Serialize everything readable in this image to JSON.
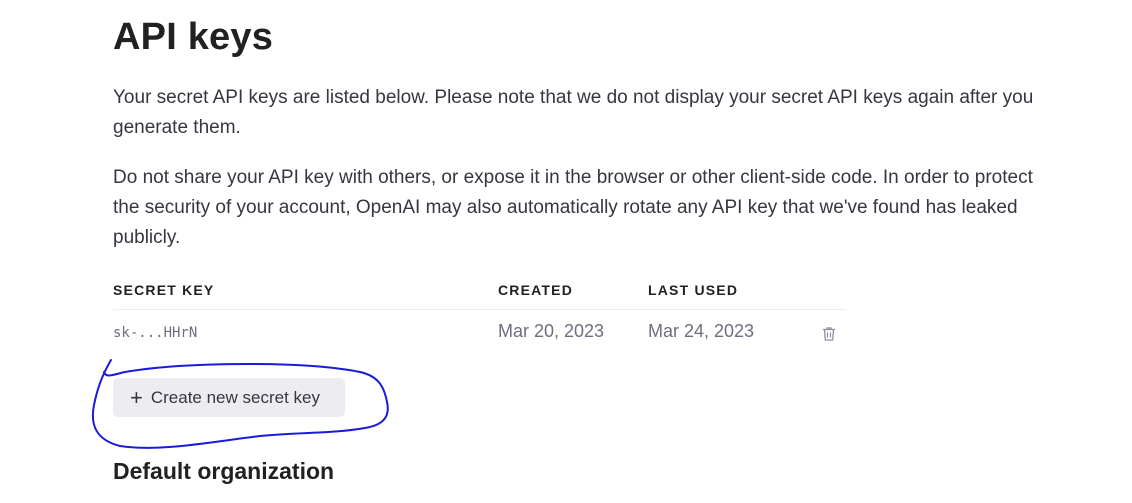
{
  "page": {
    "title": "API keys",
    "description_1": "Your secret API keys are listed below. Please note that we do not display your secret API keys again after you generate them.",
    "description_2": "Do not share your API key with others, or expose it in the browser or other client-side code. In order to protect the security of your account, OpenAI may also automatically rotate any API key that we've found has leaked publicly."
  },
  "table": {
    "headers": {
      "secret_key": "SECRET KEY",
      "created": "CREATED",
      "last_used": "LAST USED"
    },
    "rows": [
      {
        "secret_key": "sk-...HHrN",
        "created": "Mar 20, 2023",
        "last_used": "Mar 24, 2023",
        "action_icon": "trash-icon"
      }
    ]
  },
  "actions": {
    "create_label": "Create new secret key",
    "create_icon": "plus-icon"
  },
  "sections": {
    "default_org_title": "Default organization"
  },
  "colors": {
    "text": "#353740",
    "heading": "#202123",
    "muted": "#6e6e80",
    "button_bg": "#ececf1",
    "annotation": "#1a1adb"
  }
}
